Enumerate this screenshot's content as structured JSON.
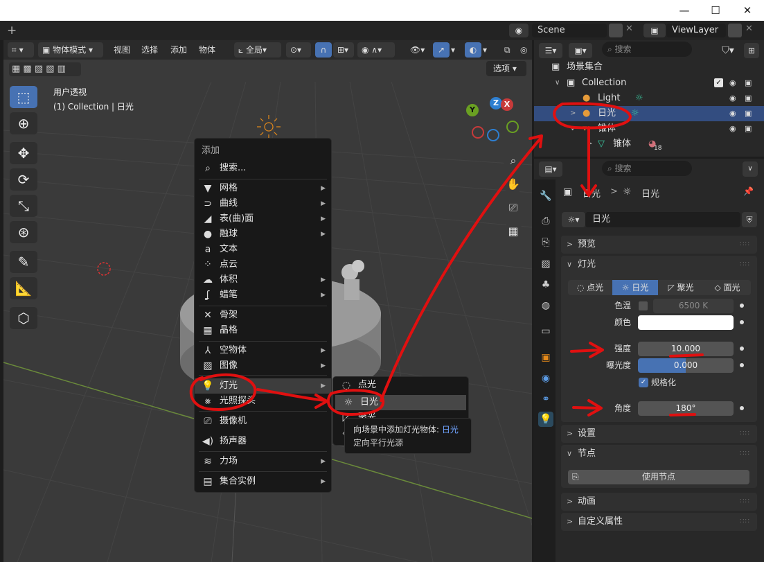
{
  "window": {
    "controls": [
      "—",
      "☐",
      "✕"
    ]
  },
  "topbar": {
    "add_tab": "+",
    "scene": "Scene",
    "view_layer": "ViewLayer"
  },
  "viewport": {
    "header": {
      "mode": "物体模式",
      "menus": [
        "视图",
        "选择",
        "添加",
        "物体"
      ],
      "transform": "全局",
      "options": "选项"
    },
    "overlay": {
      "title": "用户透视",
      "subtitle": "(1) Collection | 日光"
    },
    "gizmo": {
      "x": "X",
      "y": "Y",
      "z": "Z"
    }
  },
  "add_menu": {
    "title": "添加",
    "search": "搜索...",
    "items": [
      "网格",
      "曲线",
      "表(曲)面",
      "融球",
      "文本",
      "点云",
      "体积",
      "蜡笔",
      "骨架",
      "晶格",
      "空物体",
      "图像",
      "灯光",
      "光照探头",
      "摄像机",
      "扬声器",
      "力场",
      "集合实例"
    ]
  },
  "light_submenu": {
    "items": [
      "点光",
      "日光",
      "聚光",
      "面光"
    ]
  },
  "tooltip": {
    "line1_prefix": "向场景中添加灯光物体: ",
    "line1_name": "日光",
    "line2": "定向平行光源"
  },
  "outliner": {
    "search_placeholder": "搜索",
    "rows": [
      {
        "label": "场景集合"
      },
      {
        "label": "Collection"
      },
      {
        "label": "Light"
      },
      {
        "label": "日光"
      },
      {
        "label": "锥体"
      },
      {
        "label": "锥体",
        "badge": "18"
      }
    ]
  },
  "properties": {
    "search_placeholder": "搜索",
    "breadcrumb": [
      "日光",
      "日光"
    ],
    "datablock": "日光",
    "panels": {
      "preview": "预览",
      "light": "灯光",
      "settings": "设置",
      "nodes": "节点",
      "animation": "动画",
      "custom": "自定义属性"
    },
    "light_types": [
      "点光",
      "日光",
      "聚光",
      "面光"
    ],
    "fields": {
      "temp_label": "色温",
      "temp_value": "6500 K",
      "color_label": "颜色",
      "strength_label": "强度",
      "strength_value": "10.000",
      "exposure_label": "曝光度",
      "exposure_value": "0.000",
      "normalize_label": "规格化",
      "angle_label": "角度",
      "angle_value": "180°"
    },
    "use_nodes": "使用节点"
  },
  "colors": {
    "accent": "#4772b3",
    "annotation": "#e01010",
    "selected_row": "#334d80"
  }
}
